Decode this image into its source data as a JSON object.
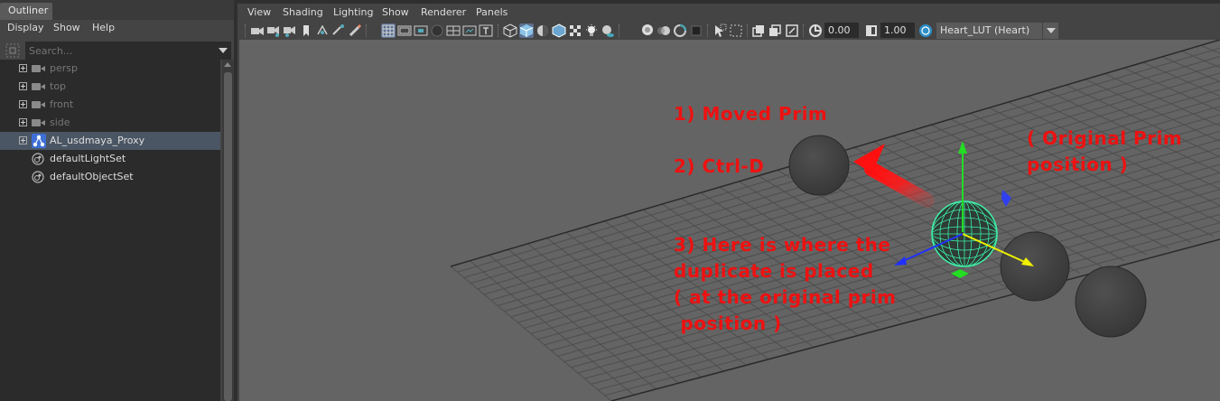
{
  "outliner": {
    "tab_label": "Outliner",
    "menu": [
      "Display",
      "Show",
      "Help"
    ],
    "search_placeholder": "Search...",
    "items": [
      {
        "label": "persp",
        "icon": "camera-icon",
        "expandable": true,
        "dim": true
      },
      {
        "label": "top",
        "icon": "camera-icon",
        "expandable": true,
        "dim": true
      },
      {
        "label": "front",
        "icon": "camera-icon",
        "expandable": true,
        "dim": true
      },
      {
        "label": "side",
        "icon": "camera-icon",
        "expandable": true,
        "dim": true
      },
      {
        "label": "AL_usdmaya_Proxy",
        "icon": "usd-proxy-icon",
        "expandable": true,
        "selected": true
      },
      {
        "label": "defaultLightSet",
        "icon": "object-set-icon",
        "expandable": false
      },
      {
        "label": "defaultObjectSet",
        "icon": "object-set-icon",
        "expandable": false
      }
    ]
  },
  "viewport": {
    "menu": [
      "View",
      "Shading",
      "Lighting",
      "Show",
      "Renderer",
      "Panels"
    ],
    "toolbar": {
      "exposure_value": "0.00",
      "gamma_value": "1.00",
      "color_transform": "Heart_LUT (Heart)"
    },
    "annotations": {
      "step1": "1) Moved Prim",
      "step2": "2) Ctrl-D",
      "original_position": "( Original Prim\nposition )",
      "step3": "3) Here is where the\nduplicate is placed\n( at the original prim\n position )"
    }
  },
  "colors": {
    "annotation": "#ee1111",
    "viewport_bg": "#646464",
    "selection_highlight": "#4b5664",
    "active_tool": "#5c7090"
  }
}
